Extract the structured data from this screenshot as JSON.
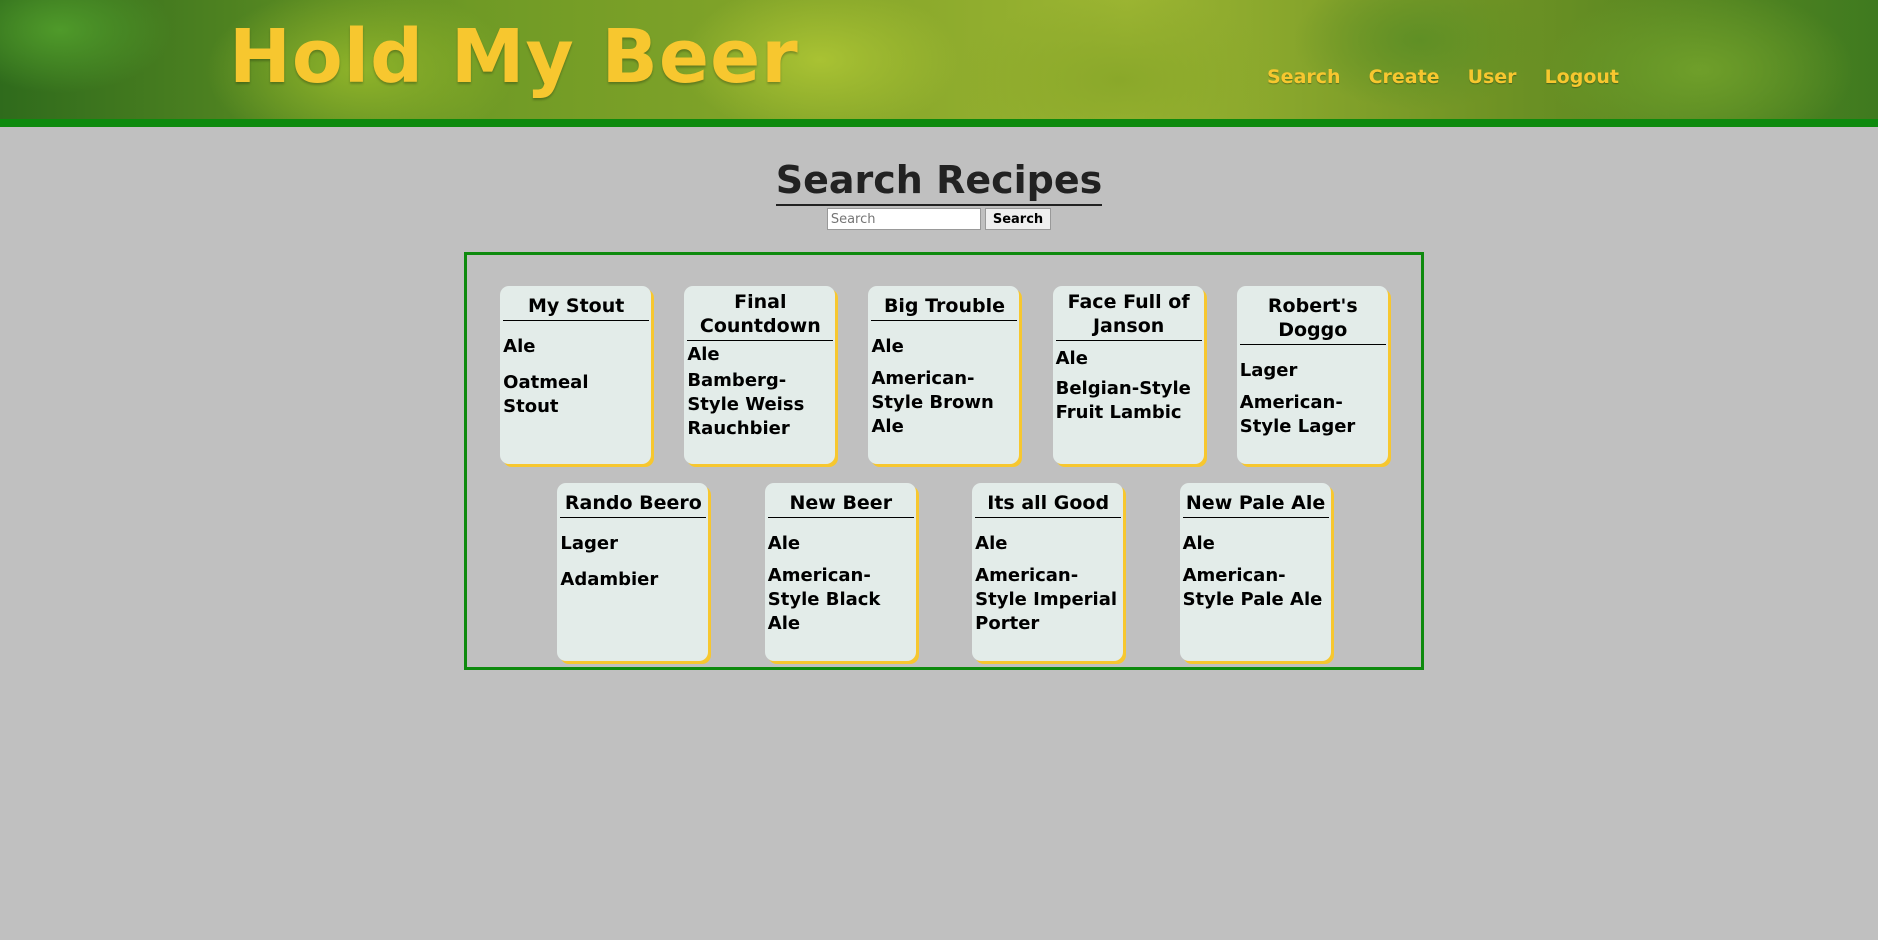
{
  "header": {
    "logo": "Hold My Beer",
    "nav": [
      "Search",
      "Create",
      "User",
      "Logout"
    ]
  },
  "colors": {
    "accent": "#f7c72f",
    "border": "#0e8a0e",
    "background": "#c0c0c0",
    "card": "#e3ece9"
  },
  "main": {
    "title": "Search Recipes",
    "search_placeholder": "Search",
    "search_button": "Search"
  },
  "recipes": [
    {
      "name": "My Stout",
      "type": "Ale",
      "style": "Oatmeal Stout"
    },
    {
      "name": "Final Countdown",
      "type": "Ale",
      "style": "Bamberg-Style Weiss Rauchbier"
    },
    {
      "name": "Big Trouble",
      "type": "Ale",
      "style": "American-Style Brown Ale"
    },
    {
      "name": "Face Full of Janson",
      "type": "Ale",
      "style": "Belgian-Style Fruit Lambic"
    },
    {
      "name": "Robert's Doggo",
      "type": "Lager",
      "style": "American-Style Lager"
    },
    {
      "name": "Rando Beero",
      "type": "Lager",
      "style": "Adambier"
    },
    {
      "name": "New Beer",
      "type": "Ale",
      "style": "American-Style Black Ale"
    },
    {
      "name": "Its all Good",
      "type": "Ale",
      "style": "American-Style Imperial Porter"
    },
    {
      "name": "New Pale Ale",
      "type": "Ale",
      "style": "American-Style Pale Ale"
    }
  ]
}
